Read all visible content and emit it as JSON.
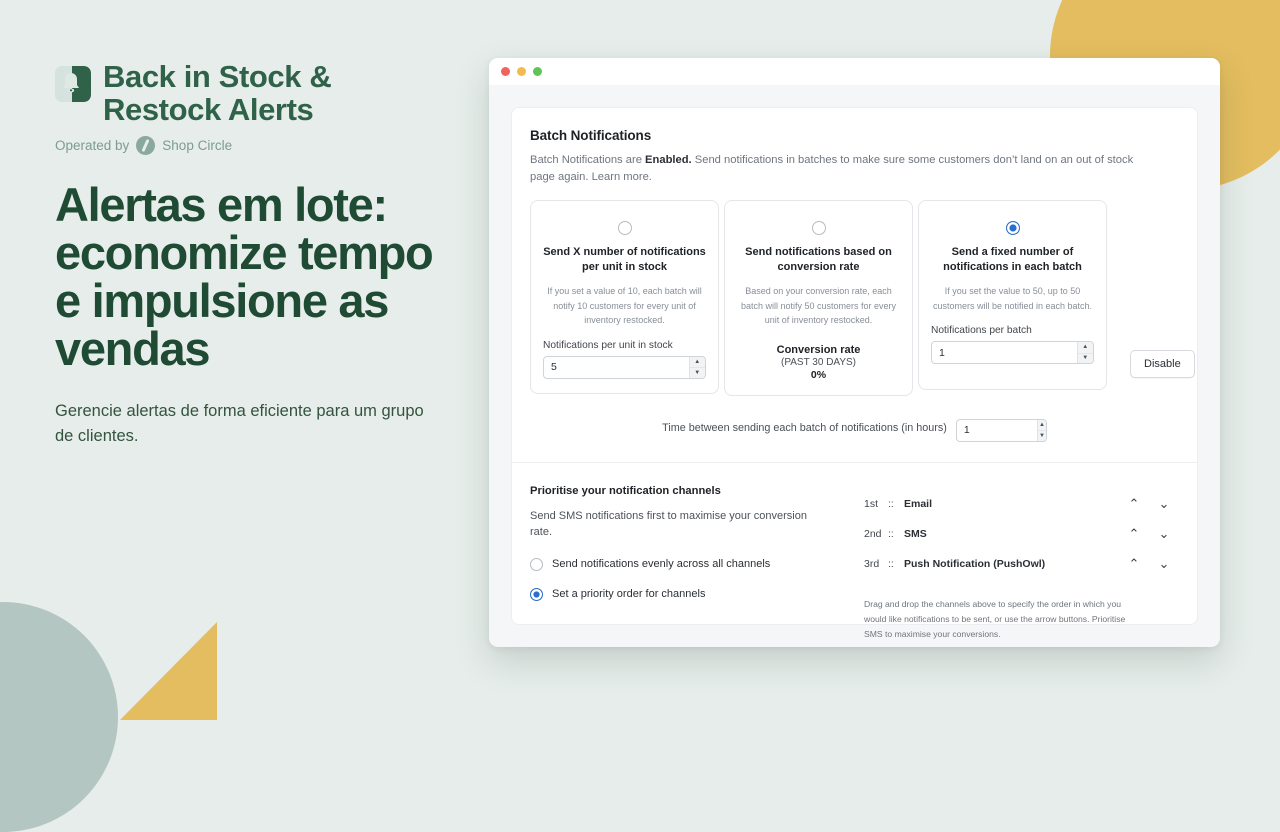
{
  "brand": {
    "name_line1": "Back in Stock &",
    "name_line2": "Restock Alerts",
    "operated_by": "Operated by",
    "partner": "Shop Circle",
    "logo_icon": "bell-icon",
    "partner_icon": "shop-circle-icon",
    "brand_color": "#2f6249"
  },
  "marketing": {
    "headline": "Alertas em lote: economize tempo e impulsione as vendas",
    "subhead": "Gerencie alertas de forma eficiente para um grupo de clientes."
  },
  "window": {
    "traffic_lights": [
      "close-red",
      "minimize-yellow",
      "maximize-green"
    ]
  },
  "batch": {
    "title": "Batch Notifications",
    "desc_part1": "Batch Notifications are ",
    "desc_status": "Enabled.",
    "desc_part2": " Send notifications in batches to make sure some customers don’t land on an out of stock page again. Learn more.",
    "disable_label": "Disable",
    "options": [
      {
        "selected": false,
        "title": "Send X number of notifications per unit in stock",
        "body": "If you set a value of 10, each batch will notify 10 customers for every unit of inventory restocked.",
        "field_label": "Notifications per unit in stock",
        "field_value": "5",
        "has_field": true
      },
      {
        "selected": false,
        "title": "Send notifications based on conversion rate",
        "body": "Based on your conversion rate, each batch will notify 50 customers for every unit of inventory restocked.",
        "has_field": false,
        "conv_title": "Conversion rate",
        "conv_sub": "(PAST 30 DAYS)",
        "conv_value": "0%"
      },
      {
        "selected": true,
        "title": "Send a fixed number of notifications in each batch",
        "body": "If you set the value to 50, up to 50 customers will be notified in each batch.",
        "field_label": "Notifications per batch",
        "field_value": "1",
        "has_field": true
      }
    ],
    "time_label": "Time between sending each batch of notifications (in hours)",
    "time_value": "1"
  },
  "priority": {
    "title": "Prioritise your notification channels",
    "desc": "Send SMS notifications first to maximise your conversion rate.",
    "radio_even": "Send notifications evenly across all channels",
    "radio_order": "Set a priority order for channels",
    "selected": "order",
    "channels": [
      {
        "rank": "1st",
        "sep": "::",
        "name": "Email"
      },
      {
        "rank": "2nd",
        "sep": "::",
        "name": "SMS"
      },
      {
        "rank": "3rd",
        "sep": "::",
        "name": "Push Notification (PushOwl)"
      }
    ],
    "help": "Drag and drop the channels above to specify the order in which you would like notifications to be sent, or use the arrow buttons. Prioritise SMS to maximise your conversions."
  },
  "accent": {
    "radio_blue": "#2c6ecb",
    "yellow": "#e3bd5f",
    "sage": "#b3c6c1"
  }
}
